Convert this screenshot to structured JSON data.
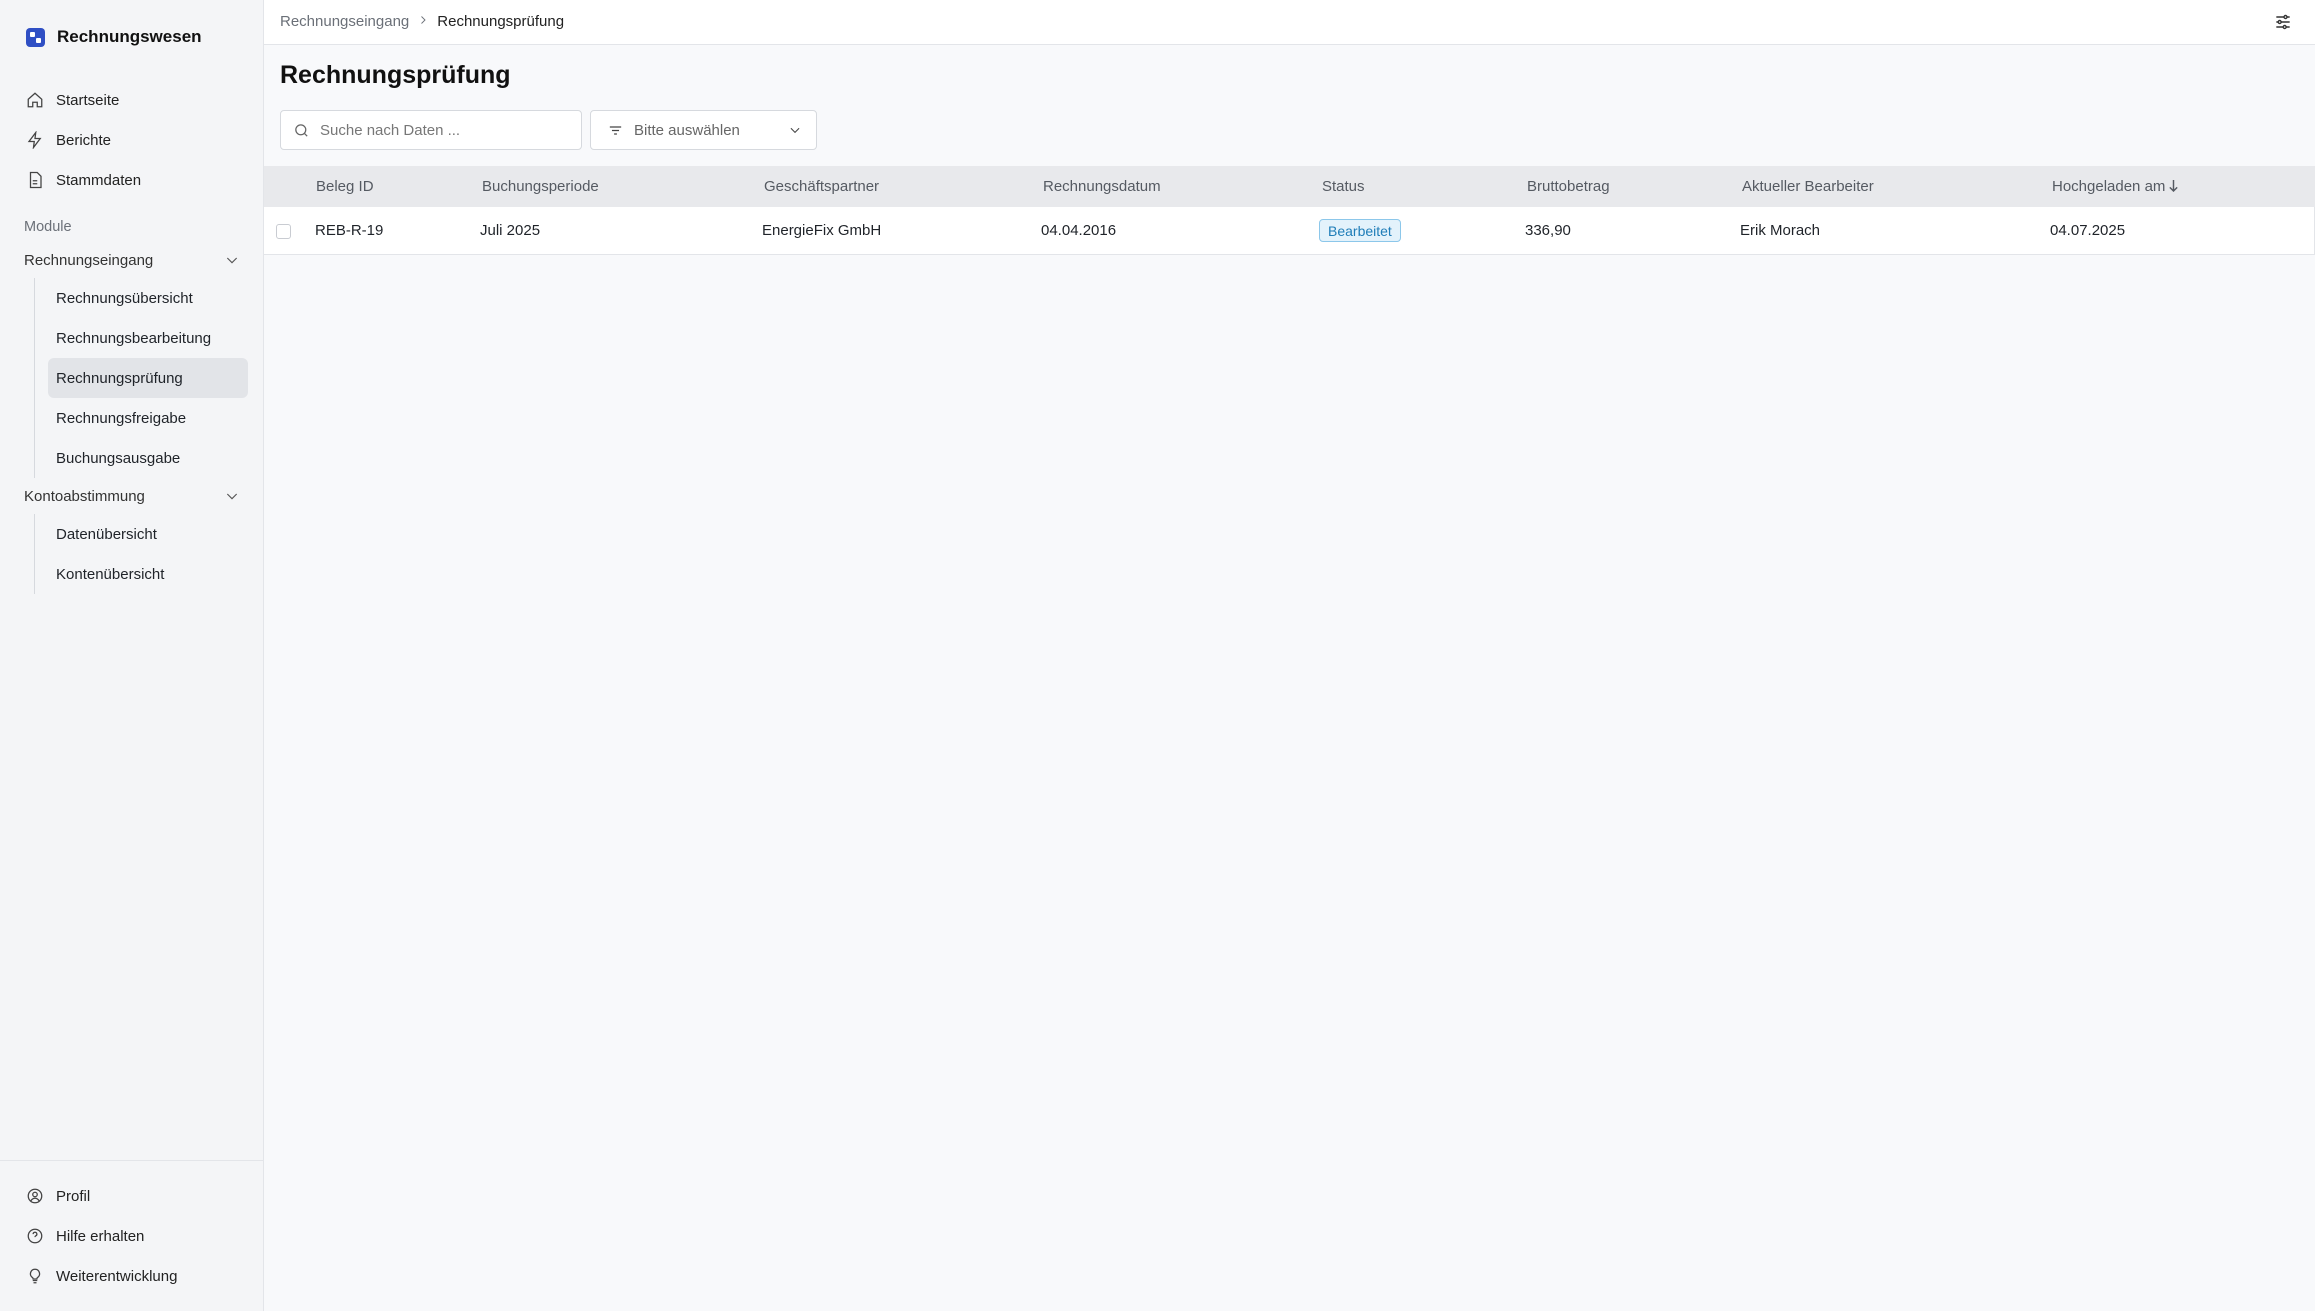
{
  "app": {
    "title": "Rechnungswesen"
  },
  "nav": {
    "top": [
      {
        "label": "Startseite",
        "icon": "home-icon"
      },
      {
        "label": "Berichte",
        "icon": "lightning-icon"
      },
      {
        "label": "Stammdaten",
        "icon": "document-icon"
      }
    ],
    "section_label": "Module",
    "groups": [
      {
        "label": "Rechnungseingang",
        "items": [
          "Rechnungsübersicht",
          "Rechnungsbearbeitung",
          "Rechnungsprüfung",
          "Rechnungsfreigabe",
          "Buchungsausgabe"
        ],
        "active": "Rechnungsprüfung"
      },
      {
        "label": "Kontoabstimmung",
        "items": [
          "Datenübersicht",
          "Kontenübersicht"
        ]
      }
    ],
    "bottom": [
      {
        "label": "Profil",
        "icon": "user-circle-icon"
      },
      {
        "label": "Hilfe erhalten",
        "icon": "help-circle-icon"
      },
      {
        "label": "Weiterentwicklung",
        "icon": "lightbulb-icon"
      }
    ]
  },
  "breadcrumb": {
    "parent": "Rechnungseingang",
    "current": "Rechnungsprüfung"
  },
  "page": {
    "title": "Rechnungsprüfung"
  },
  "search": {
    "placeholder": "Suche nach Daten ..."
  },
  "filter": {
    "placeholder": "Bitte auswählen"
  },
  "table": {
    "columns": [
      "Beleg ID",
      "Buchungsperiode",
      "Geschäftspartner",
      "Rechnungsdatum",
      "Status",
      "Bruttobetrag",
      "Aktueller Bearbeiter",
      "Hochgeladen am"
    ],
    "sorted_column": "Hochgeladen am",
    "sort_direction": "descending",
    "rows": [
      {
        "beleg_id": "REB-R-19",
        "buchungsperiode": "Juli 2025",
        "geschaeftspartner": "EnergieFix GmbH",
        "rechnungsdatum": "04.04.2016",
        "status": "Bearbeitet",
        "bruttobetrag": "336,90",
        "bearbeiter": "Erik Morach",
        "hochgeladen_am": "04.07.2025"
      }
    ]
  },
  "colors": {
    "brand": "#2f4fc4",
    "status_badge_bg": "#e3f2fb",
    "status_badge_text": "#1f7db8"
  }
}
